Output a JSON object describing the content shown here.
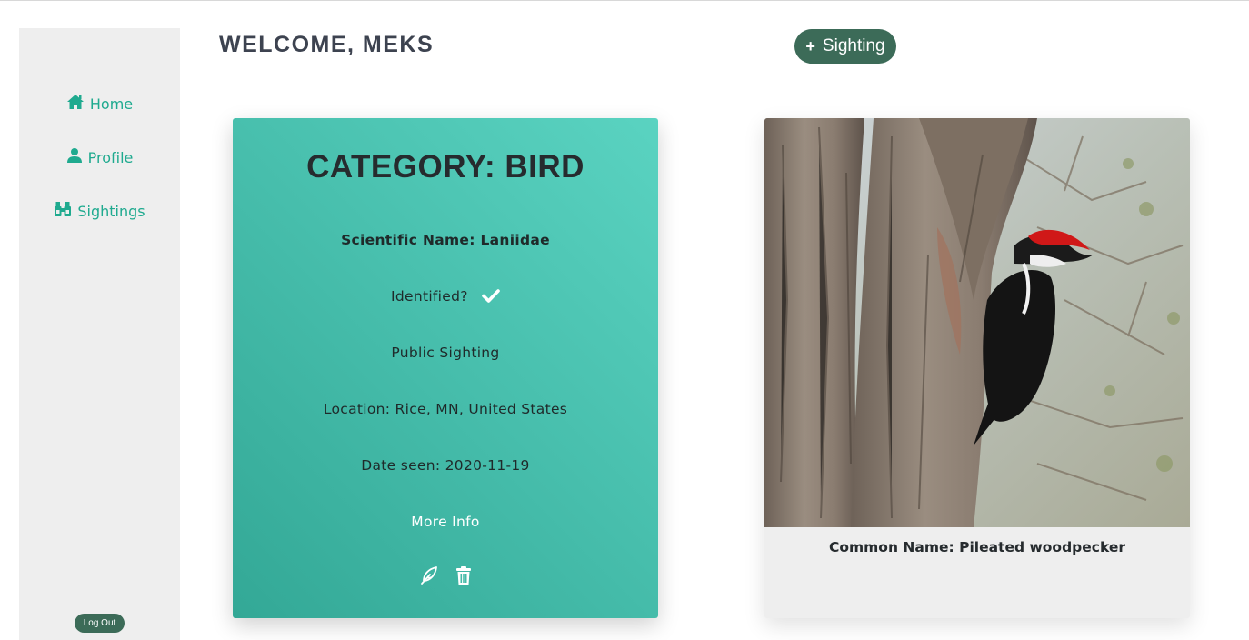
{
  "sidebar": {
    "items": [
      {
        "label": "Home",
        "icon": "home-icon"
      },
      {
        "label": "Profile",
        "icon": "user-icon"
      },
      {
        "label": "Sightings",
        "icon": "binoculars-icon"
      }
    ],
    "logout_label": "Log Out"
  },
  "header": {
    "welcome": "WELCOME, MEKS",
    "add_button_plus": "+",
    "add_button_label": "Sighting"
  },
  "sighting_card": {
    "title": "CATEGORY: BIRD",
    "scientific_name": "Scientific Name: Laniidae",
    "identified_label": "Identified?",
    "identified": true,
    "visibility": "Public Sighting",
    "location": "Location: Rice, MN, United States",
    "date_seen": "Date seen: 2020-11-19",
    "more_info": "More Info",
    "edit_icon": "feather-icon",
    "delete_icon": "trash-icon"
  },
  "photo_card": {
    "common_name": "Common Name: Pileated woodpecker"
  },
  "colors": {
    "accent": "#1faa8f",
    "button": "#3c6b58",
    "card_start": "#33a896",
    "card_end": "#5ad3c1"
  }
}
